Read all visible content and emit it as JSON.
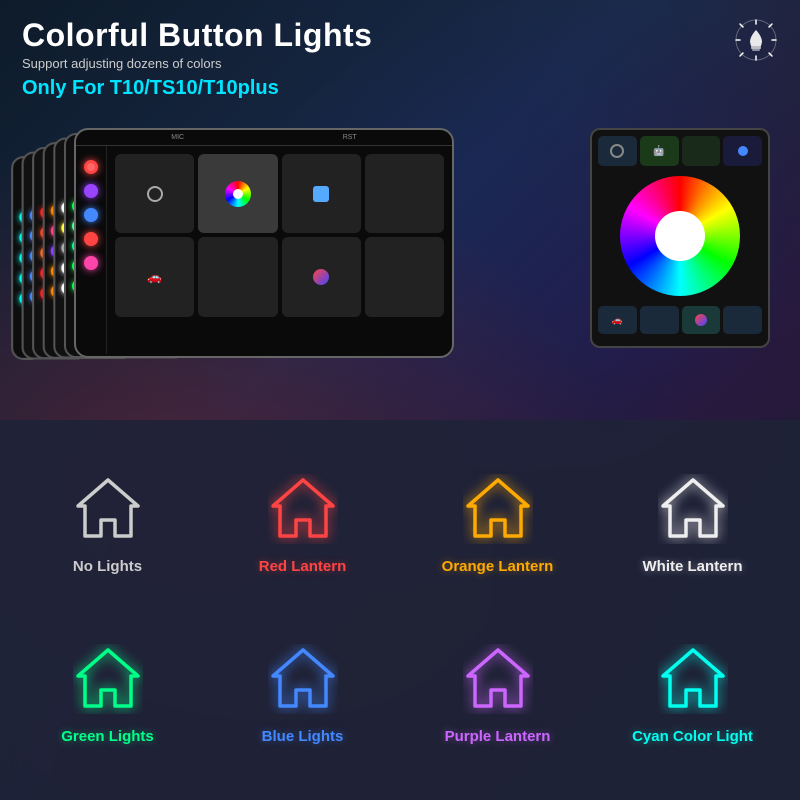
{
  "header": {
    "title": "Colorful Button Lights",
    "subtitle": "Support adjusting dozens of colors",
    "model": "Only For T10/TS10/T10plus"
  },
  "bulb_icon": "💡",
  "lights": [
    {
      "id": "no-lights",
      "label": "No Lights",
      "color": "#cccccc",
      "stroke": "#888888",
      "row": 1
    },
    {
      "id": "red-lantern",
      "label": "Red Lantern",
      "color": "#ff4444",
      "stroke": "#ff2222",
      "row": 1
    },
    {
      "id": "orange-lantern",
      "label": "Orange Lantern",
      "color": "#ffaa00",
      "stroke": "#ff8800",
      "row": 1
    },
    {
      "id": "white-lantern",
      "label": "White Lantern",
      "color": "#eeeeee",
      "stroke": "#cccccc",
      "row": 1
    },
    {
      "id": "green-lights",
      "label": "Green Lights",
      "color": "#00ff88",
      "stroke": "#00dd66",
      "row": 2
    },
    {
      "id": "blue-lights",
      "label": "Blue Lights",
      "color": "#4488ff",
      "stroke": "#2266ff",
      "row": 2
    },
    {
      "id": "purple-lantern",
      "label": "Purple Lantern",
      "color": "#cc66ff",
      "stroke": "#aa44ee",
      "row": 2
    },
    {
      "id": "cyan-color-light",
      "label": "Cyan Color Light",
      "color": "#00ffee",
      "stroke": "#00ddcc",
      "row": 2
    }
  ],
  "device_columns": [
    {
      "colors": [
        "#ff4444",
        "#9944ff",
        "#4488ff",
        "#ff4444",
        "#ff4444"
      ]
    },
    {
      "colors": [
        "#00ff44",
        "#44ff88",
        "#00ff88",
        "#00ff44",
        "#00ff44"
      ]
    },
    {
      "colors": [
        "#ffffff",
        "#ffff44",
        "#aaaaaa",
        "#ffffff",
        "#ffffff"
      ]
    },
    {
      "colors": [
        "#ff8800",
        "#ff4488",
        "#8844ff",
        "#ff8800",
        "#ff8800"
      ]
    },
    {
      "colors": [
        "#ff2222",
        "#ff4422",
        "#ff6622",
        "#ff2222",
        "#ff2222"
      ]
    },
    {
      "colors": [
        "#4488ff",
        "#44aaff",
        "#44ccff",
        "#4488ff",
        "#4488ff"
      ]
    },
    {
      "colors": [
        "#00ffee",
        "#00eedd",
        "#00ddcc",
        "#00ffee",
        "#00ffee"
      ]
    }
  ]
}
